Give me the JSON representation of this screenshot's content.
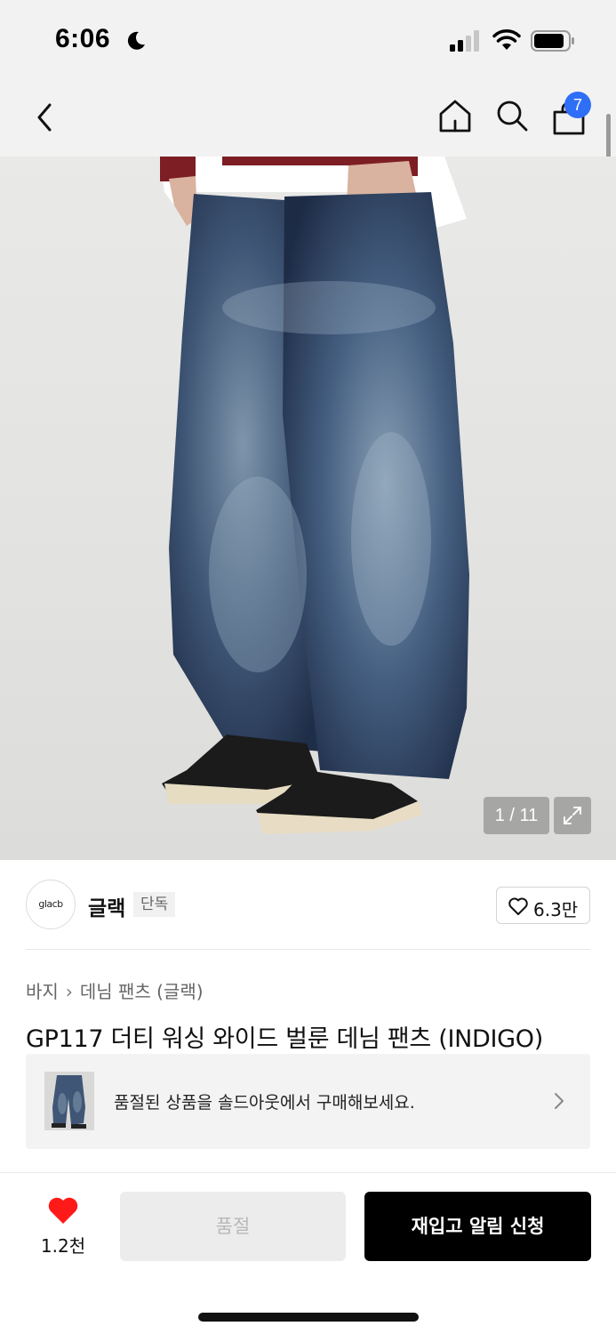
{
  "status_bar": {
    "time": "6:06",
    "icons": [
      "moon-icon",
      "signal-icon",
      "wifi-icon",
      "battery-icon"
    ]
  },
  "nav": {
    "icons": [
      "back-icon",
      "home-icon",
      "search-icon",
      "bag-icon"
    ],
    "cart_badge": "7",
    "badge_color": "#2f6ef6"
  },
  "gallery": {
    "counter": "1 / 11",
    "expand_icon": "expand-icon"
  },
  "brand": {
    "logo_text": "glacb",
    "name": "글랙",
    "badge": "단독",
    "like_count": "6.3만"
  },
  "product": {
    "breadcrumb": [
      "바지",
      "데님 팬츠 (글랙)"
    ],
    "title": "GP117 더티 워싱 와이드 벌룬 데님 팬츠 (INDIGO)"
  },
  "soldout_banner": {
    "text": "품절된 상품을 솔드아웃에서 구매해보세요."
  },
  "actions": {
    "like_count": "1.2천",
    "like_color": "#ff1a1a",
    "soldout_label": "품절",
    "restock_label": "재입고 알림 신청"
  }
}
